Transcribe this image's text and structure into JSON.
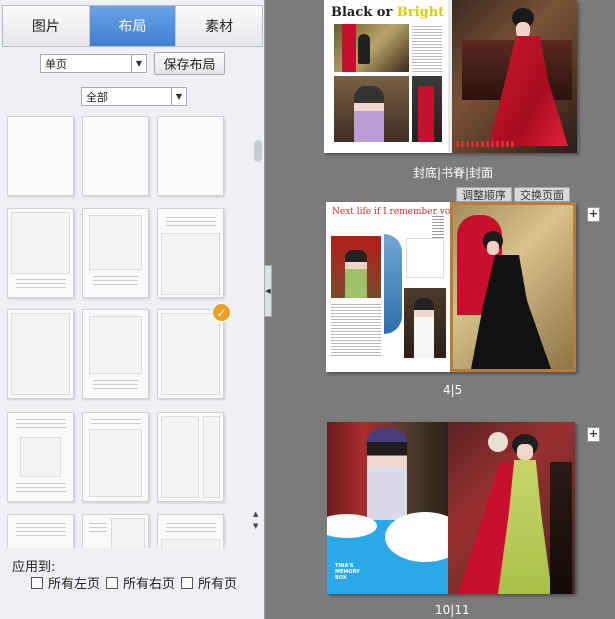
{
  "tabs": [
    {
      "label": "图片",
      "active": false
    },
    {
      "label": "布局",
      "active": true
    },
    {
      "label": "素材",
      "active": false
    }
  ],
  "toolbar": {
    "page_select_value": "单页",
    "save_layout_label": "保存布局",
    "filter_select_value": "全部"
  },
  "apply": {
    "label": "应用到:",
    "all_left": "所有左页",
    "all_right": "所有右页",
    "all_pages": "所有页"
  },
  "spreads": [
    {
      "label": "封底|书脊|封面",
      "title_prefix": "Black or ",
      "title_highlight": "Bright Liner"
    },
    {
      "label": "4|5",
      "title": "Next life if I remember you"
    },
    {
      "label": "10|11",
      "blue_text": "TINA'S MEMORY BOX"
    }
  ],
  "spread_buttons": {
    "adjust_order": "调整顺序",
    "swap_pages": "交换页面"
  },
  "icons": {
    "dropdown": "chevron-down-icon",
    "check": "check-icon",
    "add_page": "add-page-icon",
    "collapse": "chevron-left-icon"
  },
  "colors": {
    "accent": "#3f7fd1",
    "badge": "#f0a020",
    "workspace": "#7b7b7b",
    "photo_red": "#c8102e"
  }
}
